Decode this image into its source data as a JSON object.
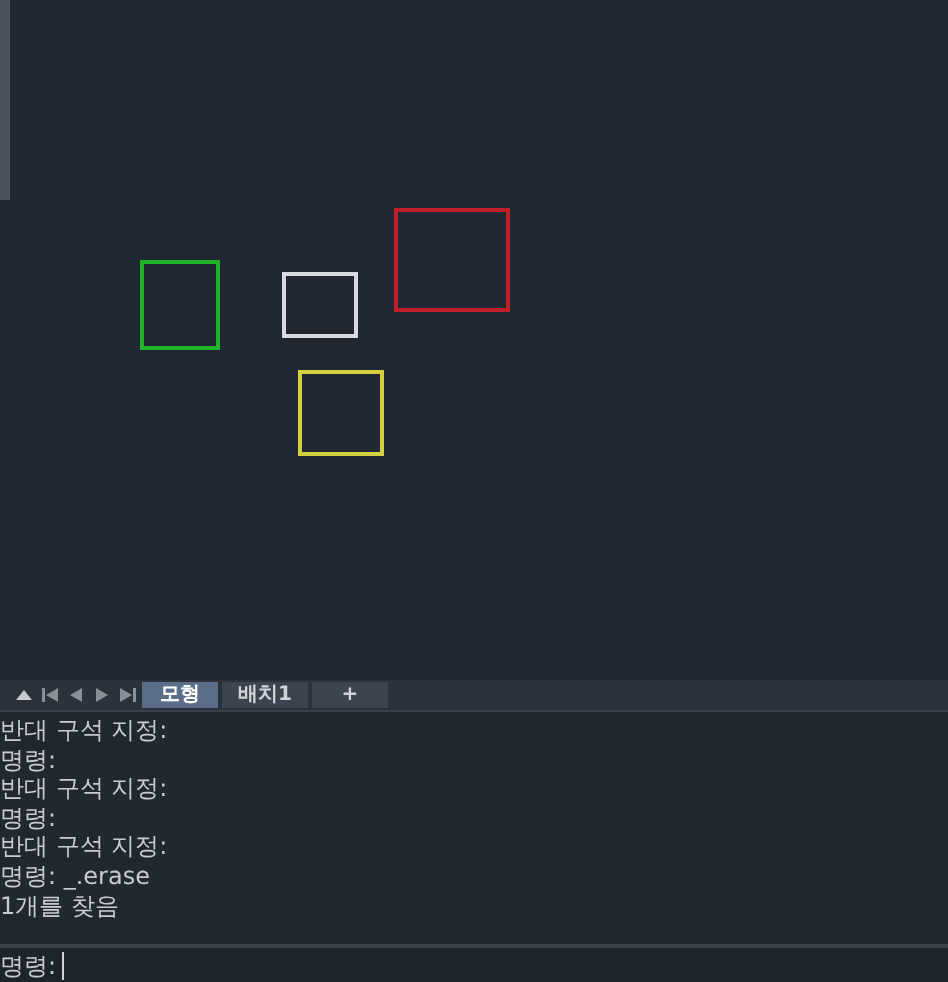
{
  "drawing": {
    "shapes": [
      {
        "kind": "rectangle",
        "color": "#1fb52a"
      },
      {
        "kind": "rectangle",
        "color": "#d8dce0"
      },
      {
        "kind": "rectangle",
        "color": "#c0202a"
      },
      {
        "kind": "rectangle",
        "color": "#d6d040"
      }
    ]
  },
  "layout_tabs": [
    {
      "label": "모형",
      "selected": true
    },
    {
      "label": "배치1",
      "selected": false
    },
    {
      "label": "+",
      "selected": false
    }
  ],
  "command_history": [
    "반대 구석 지정:",
    "명령:",
    "반대 구석 지정:",
    "명령:",
    "반대 구석 지정:",
    "명령: _.erase",
    "1개를 찾음"
  ],
  "command_line": {
    "prompt": "명령:"
  }
}
